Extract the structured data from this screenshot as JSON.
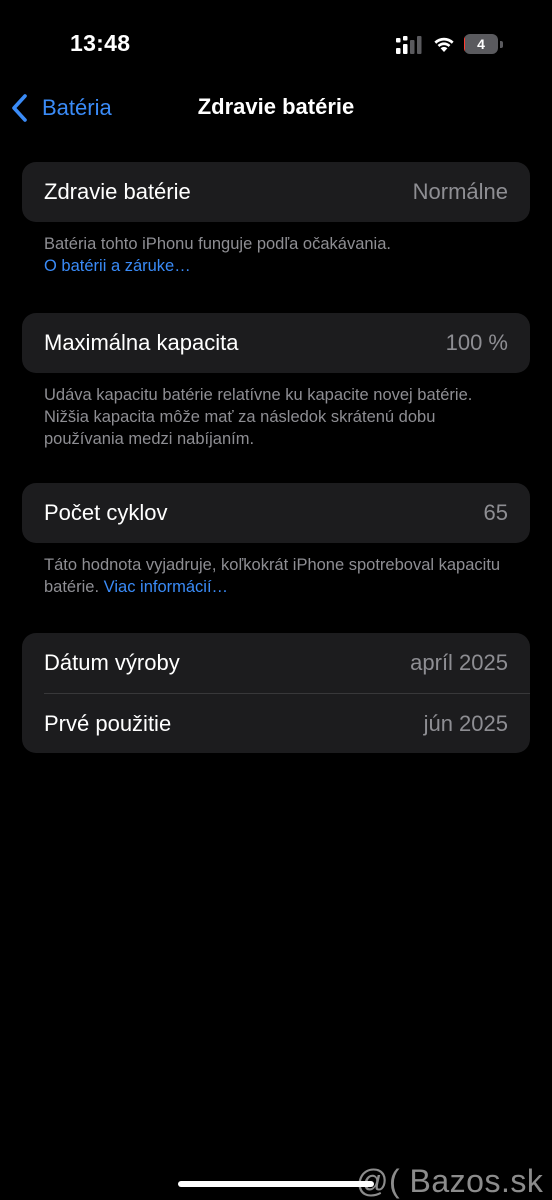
{
  "status_bar": {
    "time": "13:48",
    "battery_level": "4",
    "battery_fraction": 0.04,
    "signal_icon": "cellular-signal-icon",
    "wifi_icon": "wifi-icon",
    "battery_icon": "battery-icon"
  },
  "nav": {
    "back_label": "Batéria",
    "back_icon": "chevron-left-icon",
    "title": "Zdravie batérie"
  },
  "health": {
    "label": "Zdravie batérie",
    "value": "Normálne",
    "footnote": "Batéria tohto iPhonu funguje podľa očakávania.",
    "link": "O batérii a záruke…"
  },
  "capacity": {
    "label": "Maximálna kapacita",
    "value": "100 %",
    "footnote": "Udáva kapacitu batérie relatívne ku kapacite novej batérie. Nižšia kapacita môže mať za následok skrátenú dobu používania medzi nabíjaním."
  },
  "cycles": {
    "label": "Počet cyklov",
    "value": "65",
    "footnote": "Táto hodnota vyjadruje, koľkokrát iPhone spotreboval kapacitu batérie.",
    "link": "Viac informácií…"
  },
  "dates": {
    "manufacture_label": "Dátum výroby",
    "manufacture_value": "apríl 2025",
    "first_use_label": "Prvé použitie",
    "first_use_value": "jún 2025"
  },
  "watermark": "@( Bazos.sk",
  "colors": {
    "background": "#000000",
    "card": "#1c1c1e",
    "accent": "#3a8bf7",
    "secondary_text": "#8e8e93",
    "battery_low": "#ff3b30"
  }
}
